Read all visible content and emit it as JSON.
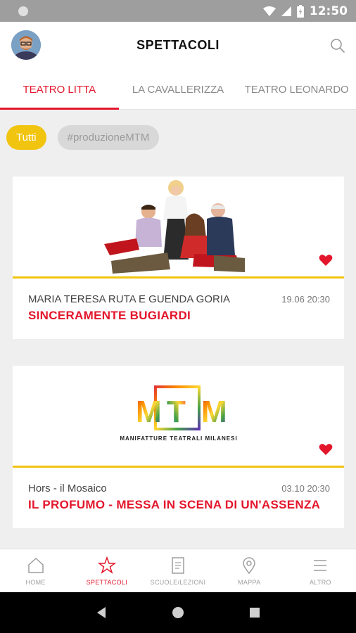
{
  "status_bar": {
    "time": "12:50"
  },
  "header": {
    "title": "SPETTACOLI"
  },
  "tabs": [
    {
      "label": "TEATRO LITTA",
      "active": true
    },
    {
      "label": "LA CAVALLERIZZA",
      "active": false
    },
    {
      "label": "TEATRO LEONARDO",
      "active": false
    }
  ],
  "filters": [
    {
      "label": "Tutti",
      "active": true
    },
    {
      "label": "#produzioneMTM",
      "active": false
    }
  ],
  "shows": [
    {
      "subtitle": "MARIA TERESA RUTA E GUENDA GORIA",
      "date": "19.06",
      "time": "20:30",
      "title": "SINCERAMENTE BUGIARDI",
      "favorite": true
    },
    {
      "subtitle": "Hors - il Mosaico",
      "date": "03.10",
      "time": "20:30",
      "title": "IL PROFUMO - MESSA IN SCENA DI UN'ASSENZA",
      "favorite": true,
      "logo": {
        "letters": [
          "M",
          "T",
          "M"
        ],
        "caption": "MANIFATTURE TEATRALI MILANESI"
      }
    }
  ],
  "bottom_nav": [
    {
      "label": "HOME",
      "icon": "home-icon",
      "active": false
    },
    {
      "label": "SPETTACOLI",
      "icon": "star-icon",
      "active": true
    },
    {
      "label": "SCUOLE/LEZIONI",
      "icon": "document-icon",
      "active": false
    },
    {
      "label": "MAPPA",
      "icon": "map-pin-icon",
      "active": false
    },
    {
      "label": "ALTRO",
      "icon": "menu-icon",
      "active": false
    }
  ],
  "colors": {
    "accent": "#e3162b",
    "chip_active": "#f1c40f",
    "divider": "#f1c40f"
  }
}
